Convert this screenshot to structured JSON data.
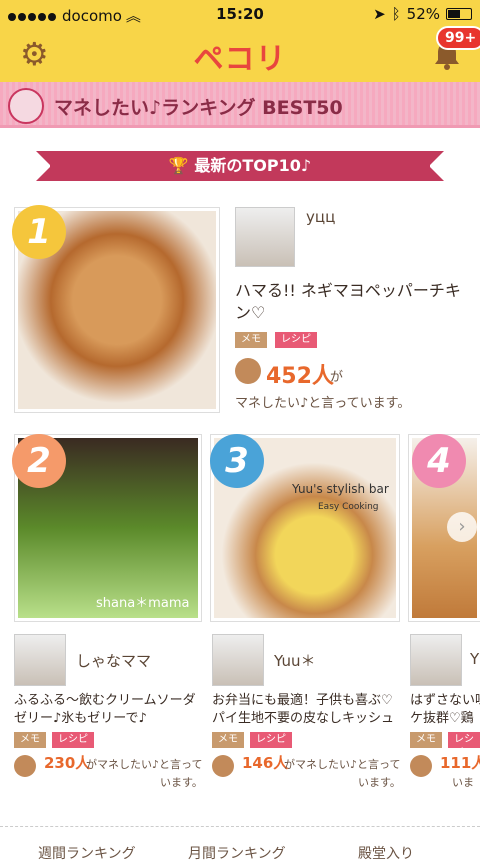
{
  "status": {
    "carrier": "docomo",
    "time": "15:20",
    "battery": "52%"
  },
  "app": {
    "logo": "ペコリ",
    "badge": "99+"
  },
  "banner": {
    "title": "マネしたい♪ランキング BEST50"
  },
  "section": {
    "title": "最新のTOP10♪"
  },
  "first": {
    "rank": "1",
    "user": "уцц",
    "title_line1": "ハマる!! ネギマヨペッパーチキ",
    "title_line2": "ン♡",
    "tag_memo": "メモ",
    "tag_recipe": "レシピ",
    "count": "452人",
    "count_suffix": "が",
    "caption": "マネしたい♪と言っています。"
  },
  "cards": [
    {
      "rank": "2",
      "user": "しゃなママ",
      "line1": "ふるふる～飲むクリームソーダ",
      "line2": "ゼリー♪氷もゼリーで♪",
      "tag_memo": "メモ",
      "tag_recipe": "レシピ",
      "count": "230人",
      "suffix": "がマネしたい♪と言って",
      "suffix2": "います。",
      "watermark": "shana＊mama"
    },
    {
      "rank": "3",
      "user": "Yuu＊",
      "line1": "お弁当にも最適！子供も喜ぶ♡",
      "line2": "パイ生地不要の皮なしキッシュ",
      "tag_memo": "メモ",
      "tag_recipe": "レシピ",
      "count": "146人",
      "suffix": "がマネしたい♪と言って",
      "suffix2": "います。",
      "overlay1": "Yuu's stylish bar",
      "overlay2": "Easy Cooking"
    },
    {
      "rank": "4",
      "user": "Y",
      "line1": "はずさない味",
      "line2": "ケ抜群♡鶏",
      "tag_memo": "メモ",
      "tag_recipe": "レシピ",
      "count": "111人",
      "suffix": "",
      "suffix2": "いま"
    }
  ],
  "bottom": {
    "t1": "週間ランキング",
    "t2": "月間ランキング",
    "t3": "殿堂入り"
  }
}
